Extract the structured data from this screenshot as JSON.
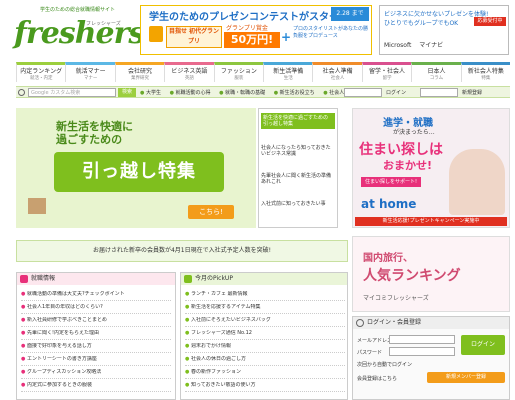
{
  "header": {
    "tagline": "学生のための総合就職情報サイト",
    "logo": "freshers",
    "logo_sub": "フレッシャーズ"
  },
  "banner": {
    "title": "学生のためのプレゼンコンテストがスタート!",
    "date": "2.28 まで",
    "grand_prix": "目指せ 初代グランプリ",
    "prize_label": "グランプリ賞金",
    "prize": "50万円!",
    "plus": "+",
    "side_text": "プロのスタイリストがあなたの勝負服をプロデュース"
  },
  "right_banner": {
    "line1": "ビジネスに欠かせないプレゼンを体験!",
    "line2": "ひとりでもグループでもOK",
    "badge": "応募受付中",
    "sponsors": [
      "Microsoft",
      "マイナビ"
    ]
  },
  "nav": [
    {
      "label": "内定ランキング",
      "sub": "就活・内定"
    },
    {
      "label": "就活マナー",
      "sub": "マナー"
    },
    {
      "label": "会社研究",
      "sub": "業界研究"
    },
    {
      "label": "ビジネス英語",
      "sub": "英語"
    },
    {
      "label": "ファッション",
      "sub": "服装"
    },
    {
      "label": "新生活準備",
      "sub": "生活"
    },
    {
      "label": "社会人準備",
      "sub": "社会人"
    },
    {
      "label": "留学・社会人",
      "sub": "留学"
    },
    {
      "label": "日本人",
      "sub": "コラム"
    },
    {
      "label": "新社会人特集",
      "sub": "特集"
    }
  ],
  "search": {
    "placeholder": "Google カスタム検索",
    "button": "検索",
    "links": [
      "大学生",
      "就職活動の心得",
      "就職・転職の基礎",
      "新生活お役立ち",
      "社会人デビュー"
    ],
    "right_btn1": "ログイン",
    "right_btn2": "新規登録"
  },
  "hero": {
    "line1": "新生活を快適に",
    "line2": "過ごすための",
    "main": "引っ越し特集",
    "button": "こちら!"
  },
  "hero_side": [
    "新生活を快適に過ごすための引っ越し特集",
    "社会人になったら知っておきたいビジネス常識",
    "先輩社会人に聞く新生活の準備あれこれ",
    "入社式前に知っておきたい事"
  ],
  "right_ad": {
    "t1": "進学・就職",
    "t2": "が決まったら…",
    "t3": "住まい探しは",
    "t4": "おまかせ!",
    "t5": "住まい探しをサポート!",
    "logo": "at home",
    "bar": "新生活応援!プレゼントキャンペーン実施中"
  },
  "notice": "お届けされた新卒の会員数が4月1日現在で入社式予定人数を突破!",
  "right_ad2": {
    "t1": "国内旅行、",
    "t2": "人気ランキング",
    "t3": "マイコミフレッシャーズ"
  },
  "news": {
    "title": "就職情報",
    "items": [
      "就職活動の準備は大丈夫?チェックポイント",
      "社会人1年目の年収はどのくらい?",
      "新入社員研修で学ぶべきことまとめ",
      "先輩に聞く!内定をもらえた理由",
      "面接で好印象を与える話し方",
      "エントリーシートの書き方講座",
      "グループディスカッション攻略法",
      "内定式に参加するときの服装"
    ]
  },
  "pickup": {
    "title": "今月のPickUP",
    "items": [
      "ランチ・カフェ 最新情報",
      "新生活を応援するアイテム特集",
      "入社前にそろえたいビジネスバッグ",
      "フレッシャーズ通信 No.12",
      "週末おでかけ情報",
      "社会人の休日の過ごし方",
      "春の新作ファッション",
      "知っておきたい敬語の使い方"
    ]
  },
  "login": {
    "title": "ログイン・会員登録",
    "label_user": "メールアドレス",
    "label_pass": "パスワード",
    "button": "ログイン",
    "remember": "次回から自動でログイン",
    "register_label": "会員登録はこちら",
    "register": "新規メンバー登録"
  }
}
